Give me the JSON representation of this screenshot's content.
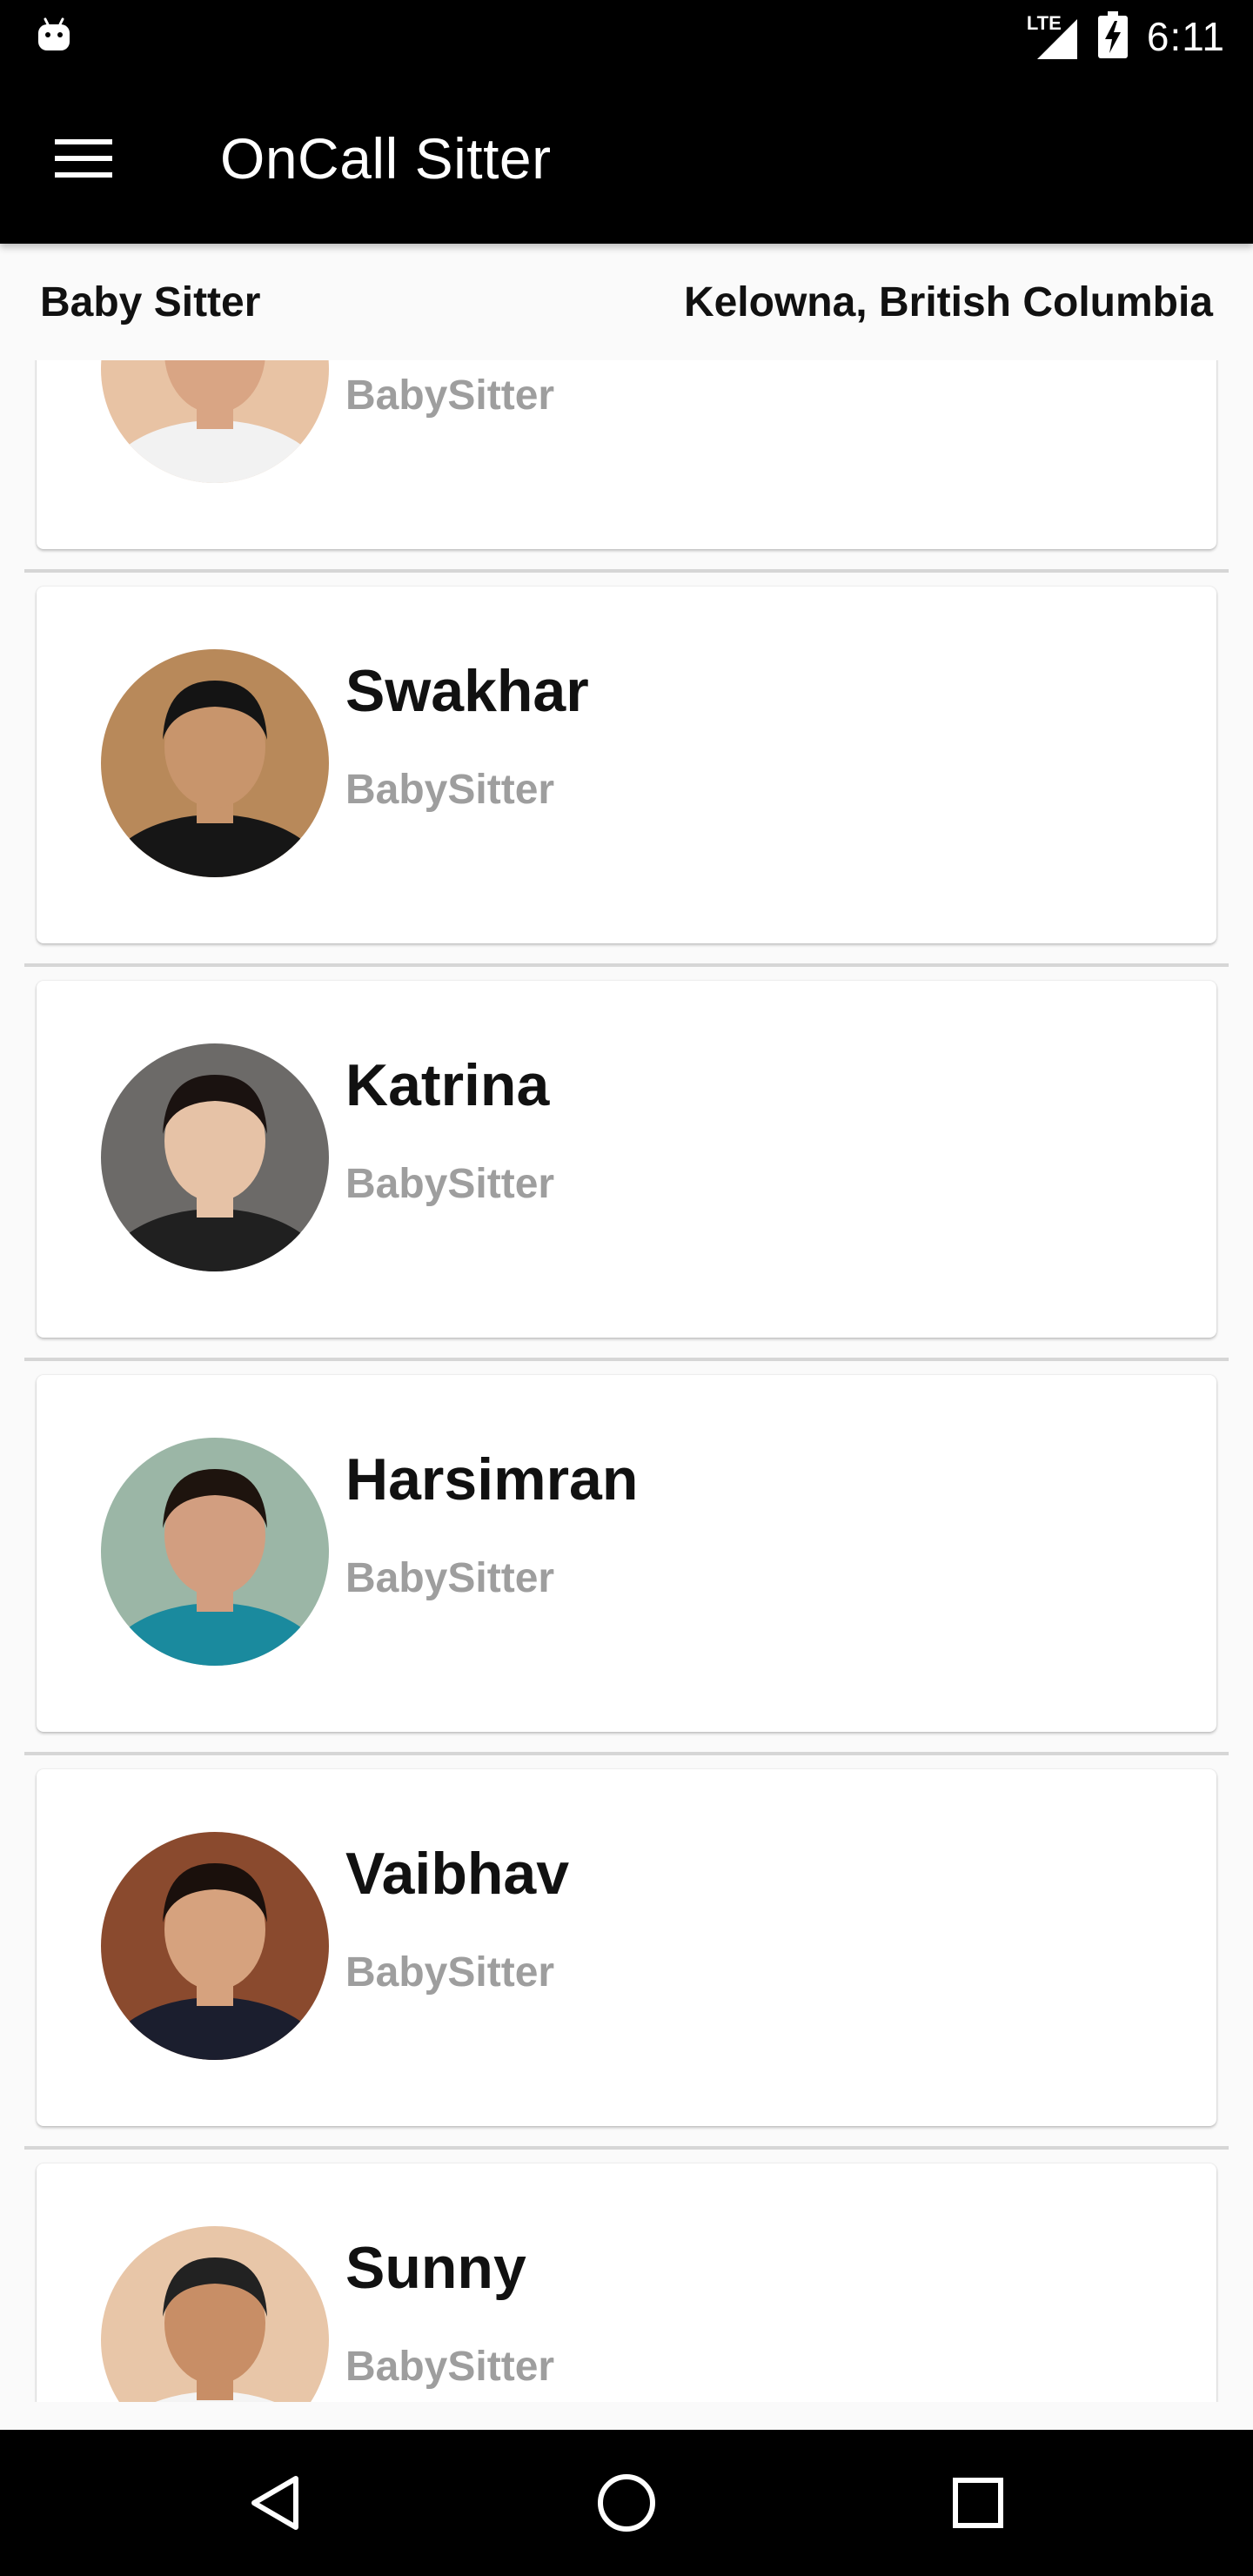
{
  "status_bar": {
    "network_label": "LTE",
    "time": "6:11"
  },
  "app_bar": {
    "title": "OnCall Sitter",
    "menu_icon": "hamburger-menu-icon"
  },
  "filter": {
    "category": "Baby Sitter",
    "location": "Kelowna, British Columbia"
  },
  "sitters": [
    {
      "name": "",
      "role": "BabySitter",
      "avatar_bg": "#e8c3a4",
      "skin": "#d9a584",
      "hair": "#2a1c14",
      "shirt": "#f2f2f2"
    },
    {
      "name": "Swakhar",
      "role": "BabySitter",
      "avatar_bg": "#b8895a",
      "skin": "#c8956c",
      "hair": "#141414",
      "shirt": "#161616"
    },
    {
      "name": "Katrina",
      "role": "BabySitter",
      "avatar_bg": "#6c6a68",
      "skin": "#e6c2a6",
      "hair": "#1a1210",
      "shirt": "#202020"
    },
    {
      "name": "Harsimran",
      "role": "BabySitter",
      "avatar_bg": "#9bb6a6",
      "skin": "#d29e80",
      "hair": "#1e140e",
      "shirt": "#1a8a9e"
    },
    {
      "name": "Vaibhav",
      "role": "BabySitter",
      "avatar_bg": "#8a4a2e",
      "skin": "#d6a27e",
      "hair": "#1a100c",
      "shirt": "#1b1e2e"
    },
    {
      "name": "Sunny",
      "role": "BabySitter",
      "avatar_bg": "#e8c6a8",
      "skin": "#c88e66",
      "hair": "#222222",
      "shirt": "#f4f4f4"
    }
  ],
  "nav_bar": {
    "back_icon": "back-triangle-icon",
    "home_icon": "home-circle-icon",
    "recents_icon": "recents-square-icon"
  },
  "colors": {
    "app_bar": "#000000",
    "background": "#fafafa",
    "card": "#ffffff",
    "role_text": "#9e9e9e",
    "name_text": "#111111"
  }
}
